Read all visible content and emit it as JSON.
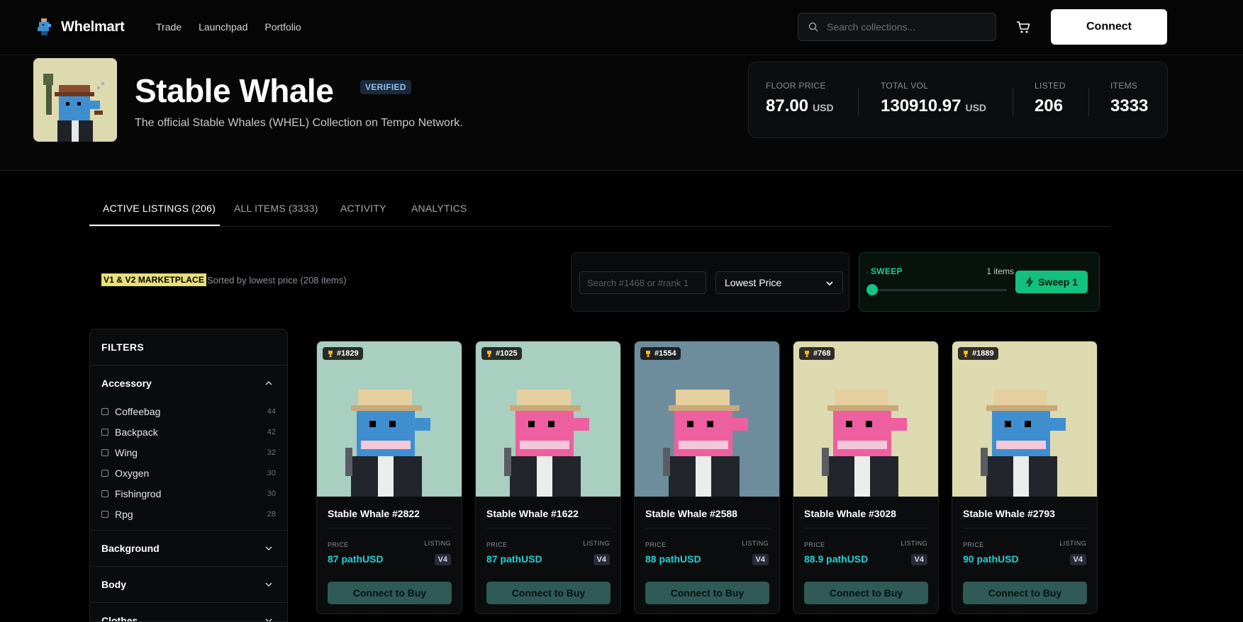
{
  "nav": {
    "brand": "Whelmart",
    "links": [
      "Trade",
      "Launchpad",
      "Portfolio"
    ],
    "search_placeholder": "Search collections...",
    "connect_label": "Connect"
  },
  "collection": {
    "name": "Stable Whale",
    "verified_label": "VERIFIED",
    "description": "The official Stable Whales (WHEL) Collection on Tempo Network.",
    "stats": [
      {
        "label": "FLOOR PRICE",
        "value": "87.00",
        "unit": "USD"
      },
      {
        "label": "TOTAL VOL",
        "value": "130910.97",
        "unit": "USD"
      },
      {
        "label": "LISTED",
        "value": "206",
        "unit": ""
      },
      {
        "label": "ITEMS",
        "value": "3333",
        "unit": ""
      }
    ]
  },
  "tabs": [
    "ACTIVE LISTINGS (206)",
    "ALL ITEMS (3333)",
    "ACTIVITY",
    "ANALYTICS"
  ],
  "toolbar": {
    "marketplace_badge": "V1 & V2 MARKETPLACE",
    "sorted_text": "Sorted by lowest price (208 items)",
    "id_search_placeholder": "Search #1468 or #rank 1",
    "sort_value": "Lowest Price",
    "sweep_label": "SWEEP",
    "sweep_count": "1 items",
    "sweep_button": "Sweep 1"
  },
  "filters": {
    "title": "FILTERS",
    "groups": [
      {
        "name": "Accessory",
        "expanded": true,
        "options": [
          {
            "label": "Coffeebag",
            "count": "44"
          },
          {
            "label": "Backpack",
            "count": "42"
          },
          {
            "label": "Wing",
            "count": "32"
          },
          {
            "label": "Oxygen",
            "count": "30"
          },
          {
            "label": "Fishingrod",
            "count": "30"
          },
          {
            "label": "Rpg",
            "count": "28"
          }
        ]
      },
      {
        "name": "Background",
        "expanded": false
      },
      {
        "name": "Body",
        "expanded": false
      },
      {
        "name": "Clothes",
        "expanded": false
      }
    ]
  },
  "card_labels": {
    "price": "PRICE",
    "listing": "LISTING",
    "buy": "Connect to Buy"
  },
  "cards": [
    {
      "rank": "#1829",
      "name": "Stable Whale #2822",
      "price": "87 pathUSD",
      "version": "V4",
      "bg": "#a9cfc0",
      "body": "#3f8fd0"
    },
    {
      "rank": "#1025",
      "name": "Stable Whale #1622",
      "price": "87 pathUSD",
      "version": "V4",
      "bg": "#a9cfc0",
      "body": "#ee5f9f"
    },
    {
      "rank": "#1554",
      "name": "Stable Whale #2588",
      "price": "88 pathUSD",
      "version": "V4",
      "bg": "#6e8d9c",
      "body": "#ee5f9f"
    },
    {
      "rank": "#768",
      "name": "Stable Whale #3028",
      "price": "88.9 pathUSD",
      "version": "V4",
      "bg": "#dedab0",
      "body": "#ee5f9f"
    },
    {
      "rank": "#1889",
      "name": "Stable Whale #2793",
      "price": "90 pathUSD",
      "version": "V4",
      "bg": "#dedab0",
      "body": "#3f8fd0"
    }
  ]
}
